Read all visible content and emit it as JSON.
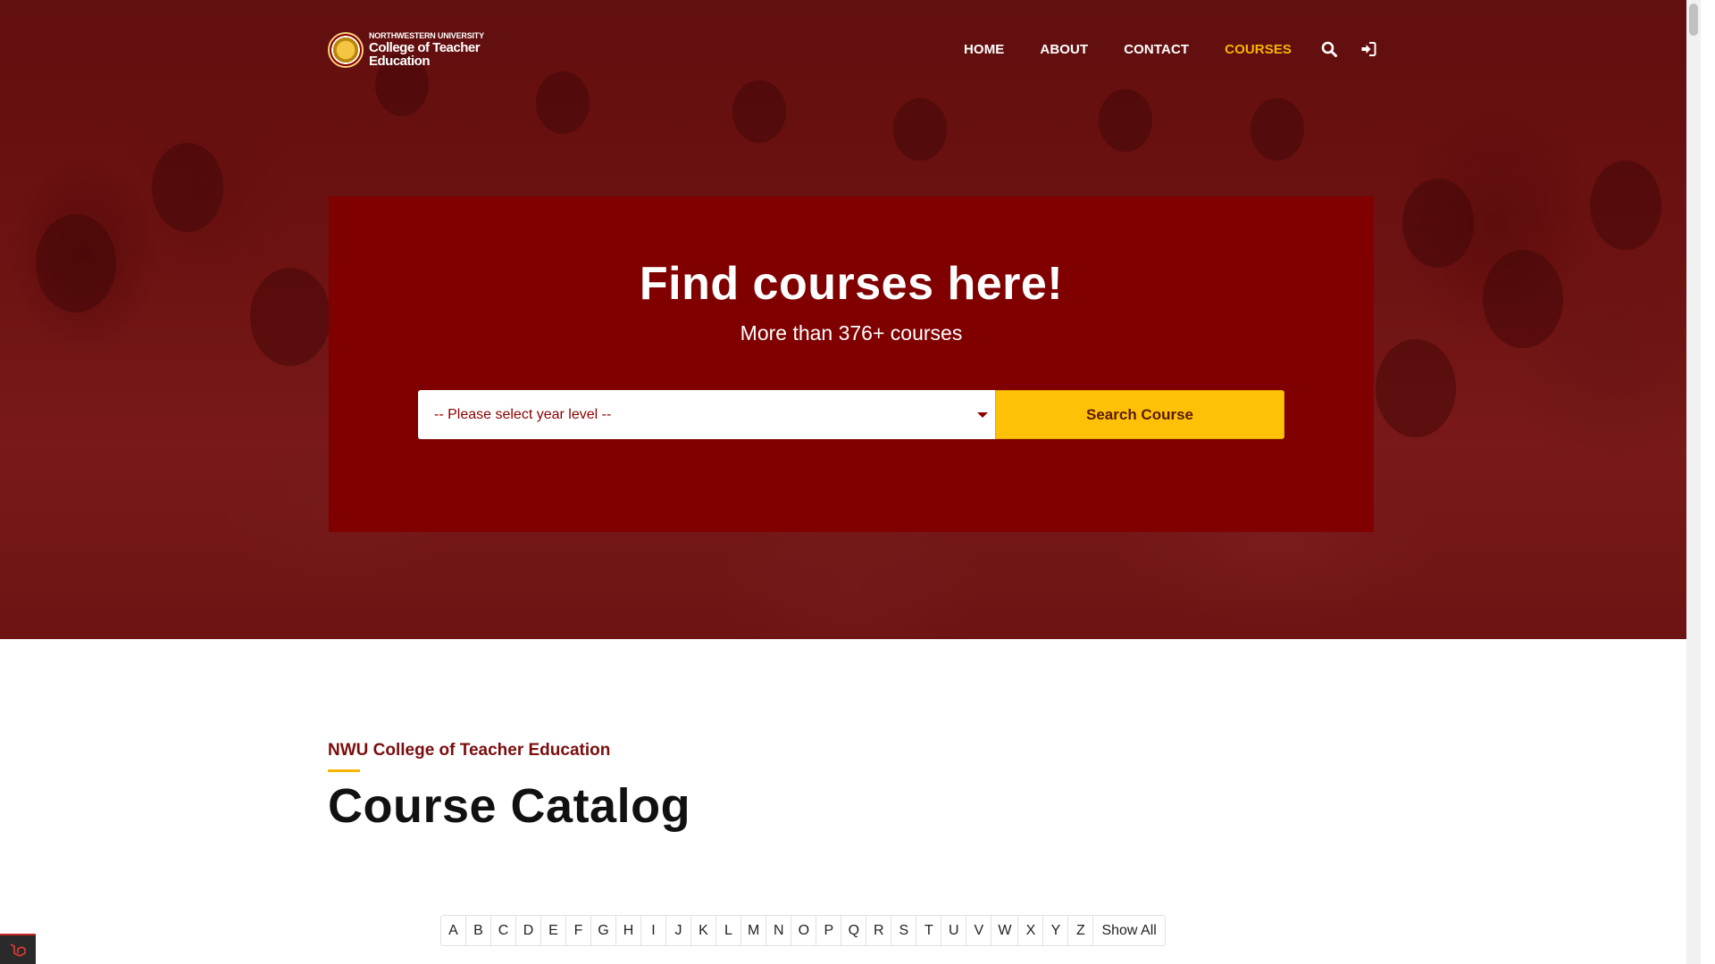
{
  "header": {
    "logo": {
      "university": "NORTHWESTERN UNIVERSITY",
      "college_line1": "College of Teacher",
      "college_line2": "Education"
    },
    "nav": {
      "home": "HOME",
      "about": "ABOUT",
      "contact": "CONTACT",
      "courses": "COURSES"
    },
    "active_nav": "COURSES"
  },
  "hero": {
    "title": "Find courses here!",
    "subtitle": "More than 376+ courses",
    "year_select": {
      "selected": "-- Please select year level --"
    },
    "search_button": "Search Course"
  },
  "catalog": {
    "eyebrow": "NWU College of Teacher Education",
    "title": "Course Catalog",
    "letters": [
      "A",
      "B",
      "C",
      "D",
      "E",
      "F",
      "G",
      "H",
      "I",
      "J",
      "K",
      "L",
      "M",
      "N",
      "O",
      "P",
      "Q",
      "R",
      "S",
      "T",
      "U",
      "V",
      "W",
      "X",
      "Y",
      "Z"
    ],
    "show_all": "Show All"
  },
  "colors": {
    "brand_maroon": "#800000",
    "accent_yellow": "#ffc107",
    "active_nav": "#f7b500"
  },
  "icons": {
    "search": "search-icon",
    "login": "sign-in-icon",
    "corner_badge": "laravel-icon",
    "select_caret": "caret-down-icon"
  }
}
